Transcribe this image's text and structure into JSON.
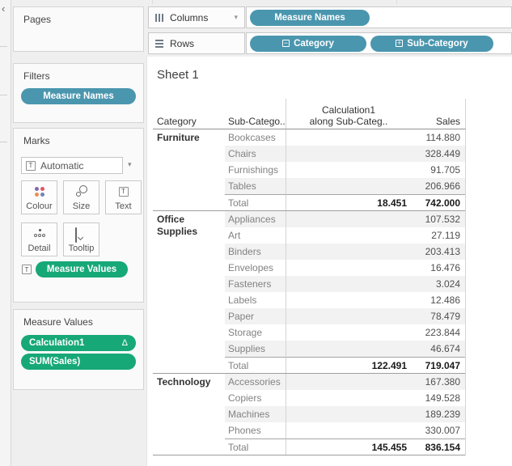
{
  "left_rail": {
    "collapse_icon": "‹"
  },
  "panels": {
    "pages": {
      "title": "Pages"
    },
    "filters": {
      "title": "Filters",
      "pills": [
        {
          "label": "Measure Names",
          "color": "blue"
        }
      ]
    },
    "marks": {
      "title": "Marks",
      "mark_type": {
        "label": "Automatic",
        "icon": "text-mark-icon",
        "chevron": "▾"
      },
      "buttons": [
        {
          "id": "colour",
          "label": "Colour"
        },
        {
          "id": "size",
          "label": "Size"
        },
        {
          "id": "text",
          "label": "Text"
        },
        {
          "id": "detail",
          "label": "Detail"
        },
        {
          "id": "tooltip",
          "label": "Tooltip"
        }
      ],
      "encoding_row": {
        "icon_letter": "T",
        "pill": "Measure Values"
      }
    },
    "measure_values": {
      "title": "Measure Values",
      "pills": [
        {
          "label": "Calculation1",
          "badge": "Δ"
        },
        {
          "label": "SUM(Sales)",
          "badge": ""
        }
      ]
    }
  },
  "shelves": {
    "columns": {
      "label": "Columns",
      "chevron": "▾",
      "pills": [
        {
          "label": "Measure Names",
          "expander": ""
        }
      ]
    },
    "rows": {
      "label": "Rows",
      "pills": [
        {
          "label": "Category",
          "expander": "−"
        },
        {
          "label": "Sub-Category",
          "expander": "+"
        }
      ]
    }
  },
  "sheet": {
    "title": "Sheet 1",
    "table": {
      "headers": {
        "category": "Category",
        "subcategory": "Sub-Catego..",
        "calc_line1": "Calculation1",
        "calc_line2": "along Sub-Categ..",
        "sales": "Sales"
      },
      "groups": [
        {
          "category": "Furniture",
          "rows": [
            {
              "subcategory": "Bookcases",
              "calc": "",
              "sales": "114.880"
            },
            {
              "subcategory": "Chairs",
              "calc": "",
              "sales": "328.449"
            },
            {
              "subcategory": "Furnishings",
              "calc": "",
              "sales": "91.705"
            },
            {
              "subcategory": "Tables",
              "calc": "",
              "sales": "206.966"
            }
          ],
          "total": {
            "label": "Total",
            "calc": "18.451",
            "sales": "742.000"
          }
        },
        {
          "category": "Office Supplies",
          "rows": [
            {
              "subcategory": "Appliances",
              "calc": "",
              "sales": "107.532"
            },
            {
              "subcategory": "Art",
              "calc": "",
              "sales": "27.119"
            },
            {
              "subcategory": "Binders",
              "calc": "",
              "sales": "203.413"
            },
            {
              "subcategory": "Envelopes",
              "calc": "",
              "sales": "16.476"
            },
            {
              "subcategory": "Fasteners",
              "calc": "",
              "sales": "3.024"
            },
            {
              "subcategory": "Labels",
              "calc": "",
              "sales": "12.486"
            },
            {
              "subcategory": "Paper",
              "calc": "",
              "sales": "78.479"
            },
            {
              "subcategory": "Storage",
              "calc": "",
              "sales": "223.844"
            },
            {
              "subcategory": "Supplies",
              "calc": "",
              "sales": "46.674"
            }
          ],
          "total": {
            "label": "Total",
            "calc": "122.491",
            "sales": "719.047"
          }
        },
        {
          "category": "Technology",
          "rows": [
            {
              "subcategory": "Accessories",
              "calc": "",
              "sales": "167.380"
            },
            {
              "subcategory": "Copiers",
              "calc": "",
              "sales": "149.528"
            },
            {
              "subcategory": "Machines",
              "calc": "",
              "sales": "189.239"
            },
            {
              "subcategory": "Phones",
              "calc": "",
              "sales": "330.007"
            }
          ],
          "total": {
            "label": "Total",
            "calc": "145.455",
            "sales": "836.154"
          }
        }
      ]
    }
  },
  "colors": {
    "pill_blue": "#4a96ae",
    "pill_green": "#17a878",
    "row_band": "#f2f2f2",
    "colour_icon_dots": [
      "#8069a9",
      "#e0556b",
      "#ef8c51",
      "#6f83b5"
    ]
  }
}
